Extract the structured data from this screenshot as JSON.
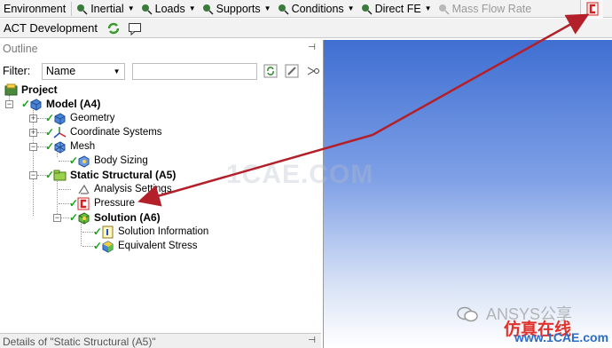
{
  "toolbar": {
    "environment": "Environment",
    "inertial": "Inertial",
    "loads": "Loads",
    "supports": "Supports",
    "conditions": "Conditions",
    "direct_fe": "Direct FE",
    "mass_flow_rate": "Mass Flow Rate"
  },
  "toolbar2": {
    "act_development": "ACT Development"
  },
  "outline": {
    "title": "Outline",
    "filter_label": "Filter:",
    "filter_value": "Name",
    "filter_text": ""
  },
  "tree": {
    "project": "Project",
    "model": "Model (A4)",
    "geometry": "Geometry",
    "coordinate_systems": "Coordinate Systems",
    "mesh": "Mesh",
    "body_sizing": "Body Sizing",
    "static_structural": "Static Structural (A5)",
    "analysis_settings": "Analysis Settings",
    "pressure": "Pressure",
    "solution": "Solution (A6)",
    "solution_information": "Solution Information",
    "equivalent_stress": "Equivalent Stress"
  },
  "details": {
    "title": "Details of \"Static Structural (A5)\""
  },
  "watermarks": {
    "center": "1CAE.COM",
    "wechat_text": "ANSYS公享",
    "logo_text": "仿真在线",
    "url": "www.1CAE.com"
  },
  "colors": {
    "annotation_arrow": "#b3202a",
    "check_green": "#1aa31a",
    "custom_load_red": "#d42020"
  }
}
